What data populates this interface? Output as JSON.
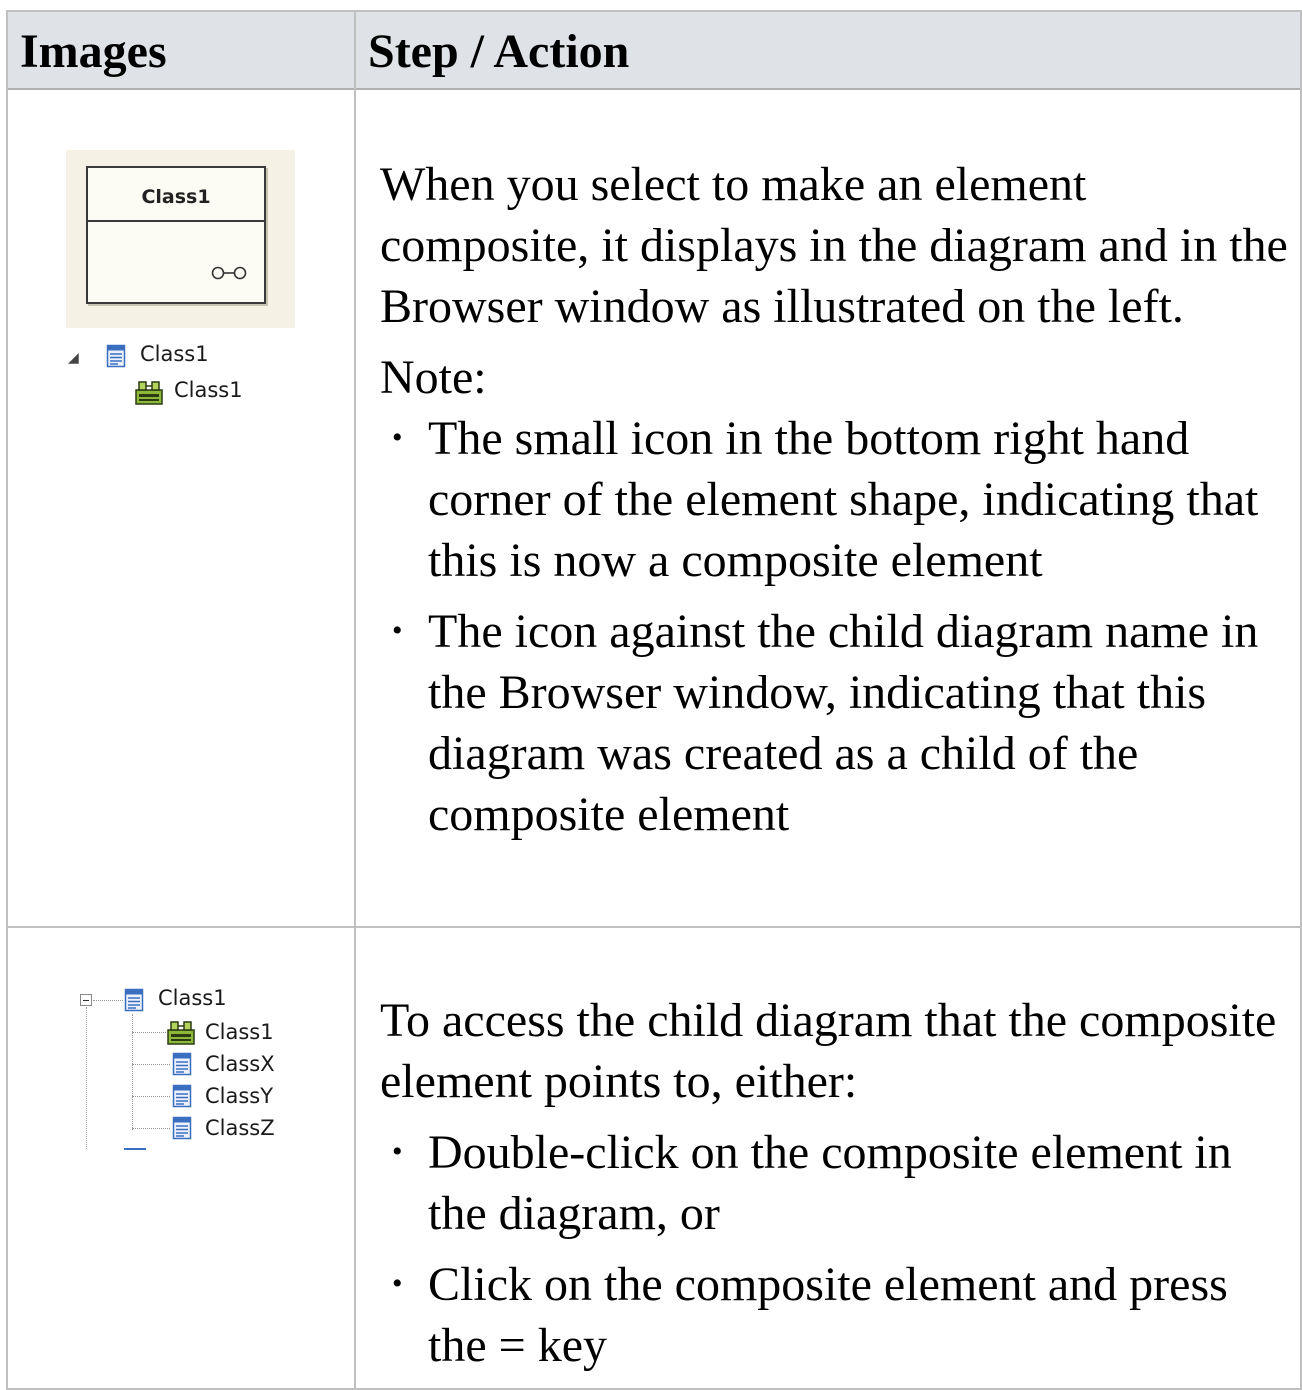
{
  "table": {
    "headers": [
      "Images",
      "Step / Action"
    ]
  },
  "row1": {
    "image": {
      "shape_name": "Class1",
      "tree": [
        {
          "label": "Class1",
          "icon": "class-icon"
        },
        {
          "label": "Class1",
          "icon": "composite-diagram-icon"
        }
      ]
    },
    "text": "When you select to make an element composite, it displays in the diagram and in the Browser window as illustrated on the left.",
    "note_label": "Note:",
    "bullets": [
      "The small icon in the bottom right hand corner of the element shape, indicating that this is now a composite element",
      "The icon against the child diagram name in the Browser window, indicating that this diagram was created as a child of the composite element"
    ]
  },
  "row2": {
    "image": {
      "tree": [
        {
          "label": "Class1",
          "icon": "class-icon"
        },
        {
          "label": "Class1",
          "icon": "composite-diagram-icon"
        },
        {
          "label": "ClassX",
          "icon": "class-icon"
        },
        {
          "label": "ClassY",
          "icon": "class-icon"
        },
        {
          "label": "ClassZ",
          "icon": "class-icon"
        }
      ]
    },
    "text": "To access the child diagram that the composite element points to, either:",
    "bullets": [
      "Double-click on the composite element in the diagram, or",
      "Click on the composite element and press the = key"
    ]
  },
  "colors": {
    "header_bg": "#dfe3e8",
    "border": "#c0c0c0",
    "shape_bg": "#f5f1e4",
    "icon_green": "#6a9a1a",
    "icon_blue": "#3a6fc0"
  }
}
